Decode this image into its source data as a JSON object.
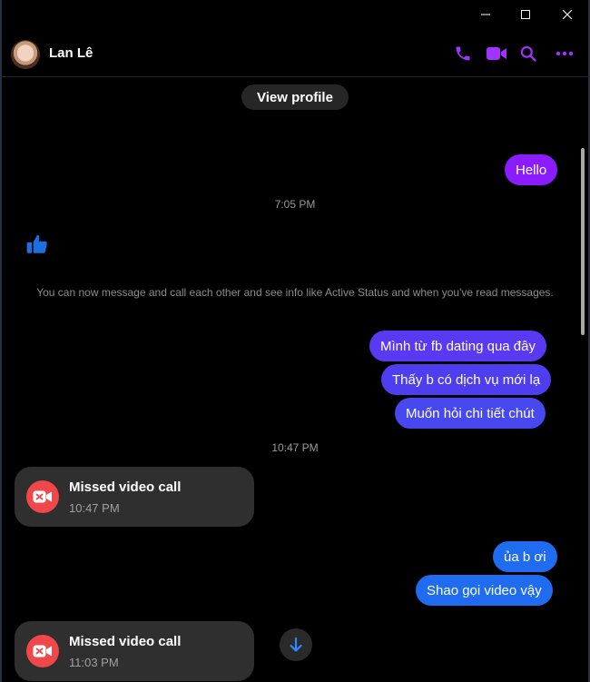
{
  "window": {
    "controls": [
      "minimize",
      "maximize",
      "close"
    ]
  },
  "header": {
    "contact_name": "Lan Lê",
    "icons": [
      "phone-icon",
      "video-camera-icon",
      "search-icon",
      "more-options-icon"
    ],
    "accent_color": "#a033ff"
  },
  "chat": {
    "view_profile_label": "View profile",
    "messages": {
      "hello": "Hello",
      "time_1": "7:05 PM",
      "system_notice": "You can now message and call each other and see info like Active Status and when you've read messages.",
      "out_1": "Mình từ fb dating qua đây",
      "out_2": "Thấy b có dịch vụ mới lạ",
      "out_3": "Muốn hỏi chi tiết chút",
      "time_2": "10:47 PM",
      "call_1_title": "Missed video call",
      "call_1_time": "10:47 PM",
      "out_4": "ủa b ơi",
      "out_5": "Shao gọi video vậy",
      "call_2_title": "Missed video call",
      "call_2_time": "11:03 PM"
    },
    "colors": {
      "bubble_purple": "#8a1cff",
      "bubble_indigo": "#4f3ef0",
      "bubble_blue": "#1f6cf0",
      "like_blue": "#1d6fe0",
      "missed_call_red": "#f0474b"
    }
  }
}
